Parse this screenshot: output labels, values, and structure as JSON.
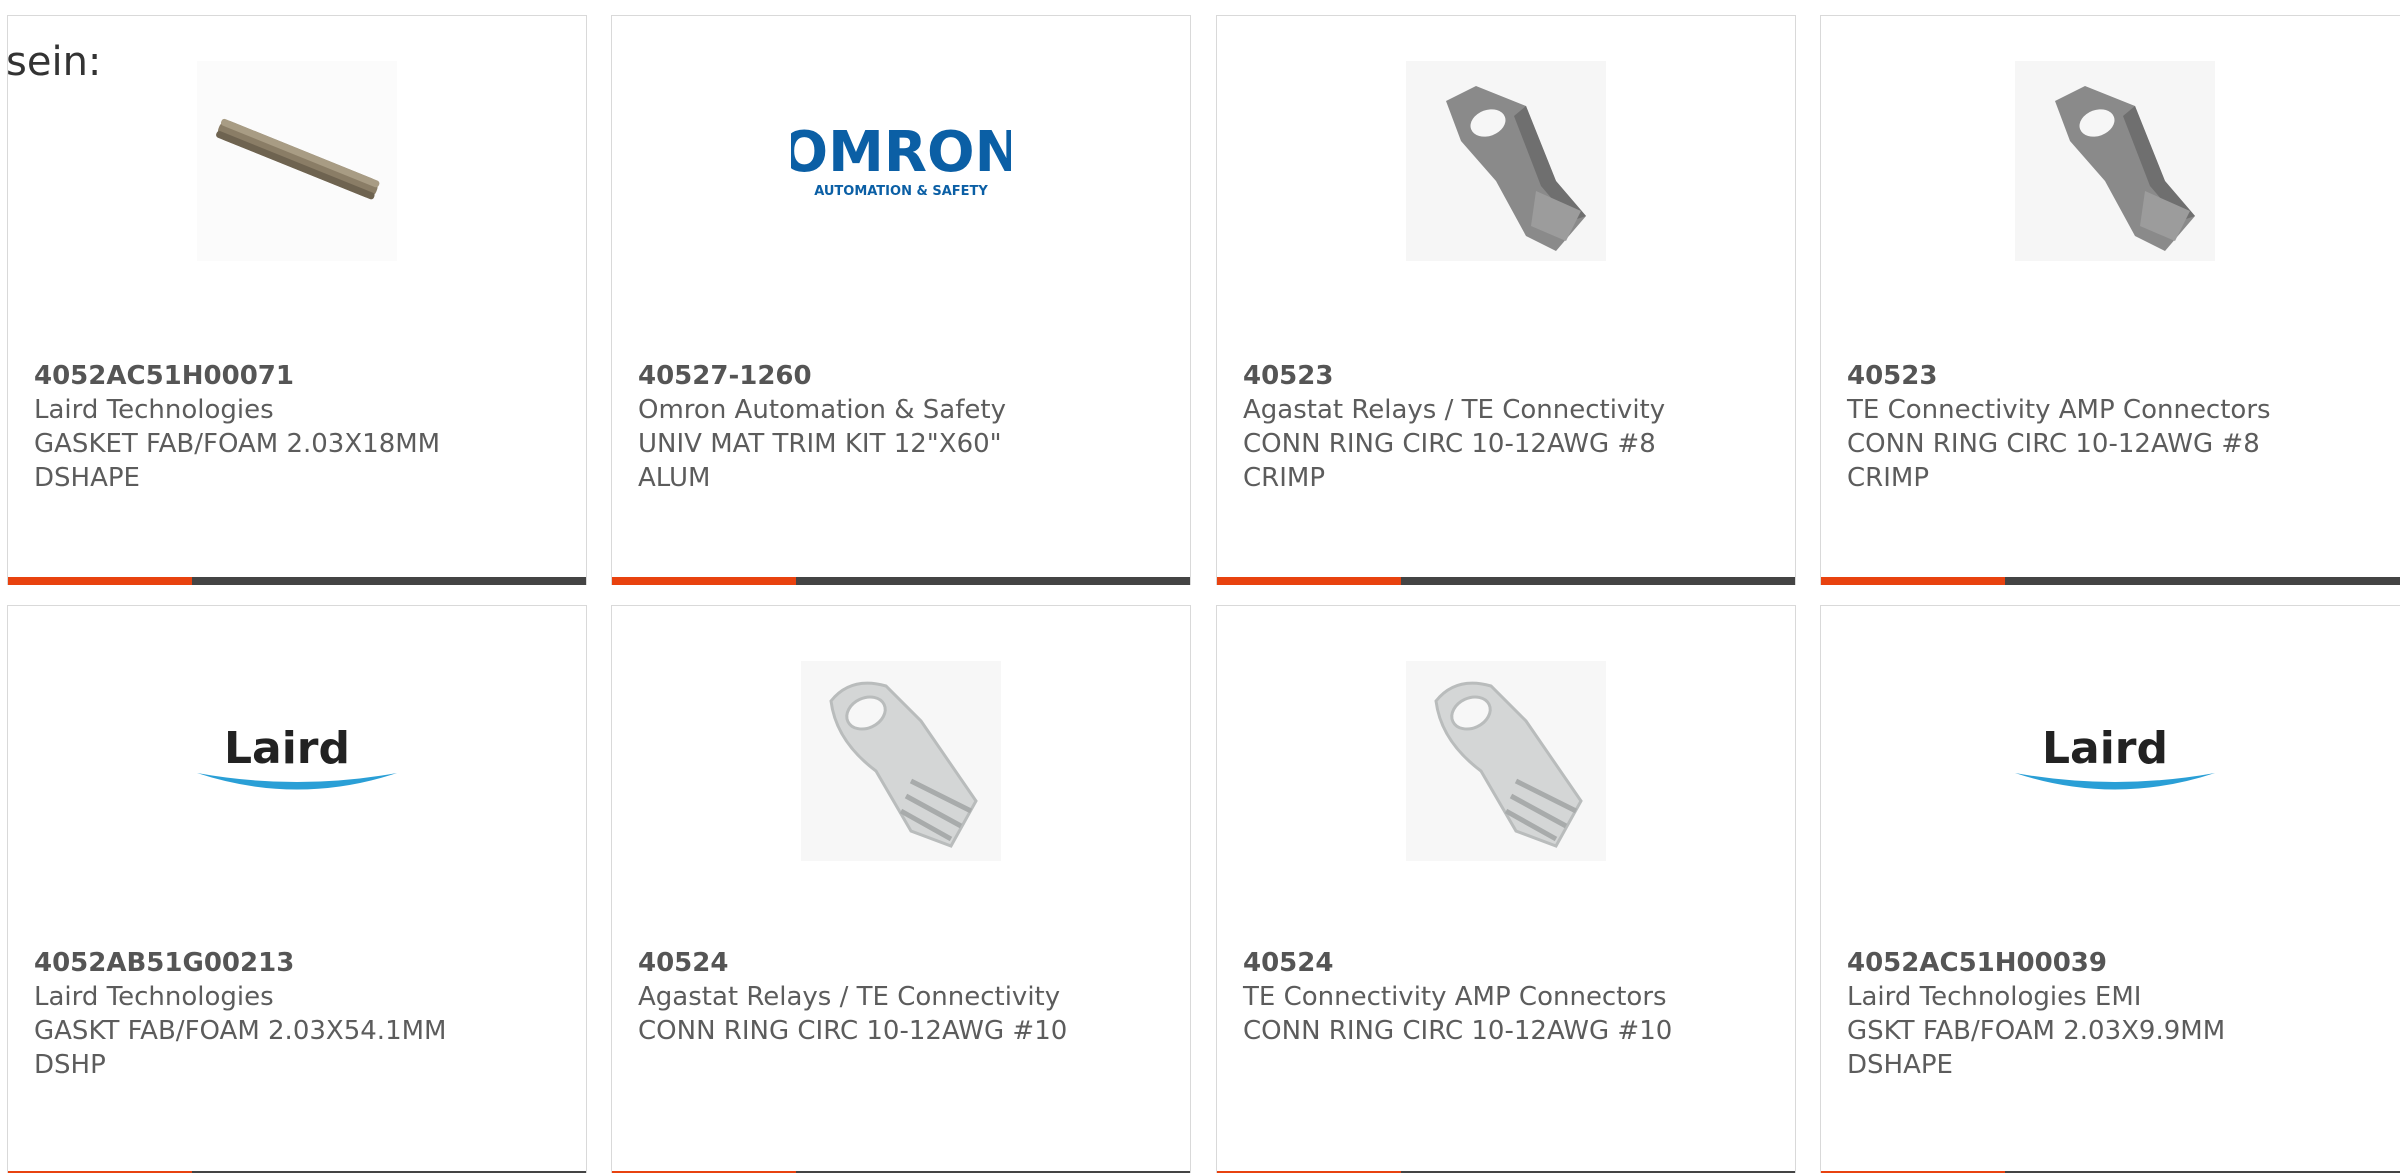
{
  "intro_text": "sein:",
  "colors": {
    "accent": "#e8420f",
    "bar": "#444444",
    "border": "#d9d9d9",
    "text": "#5c5c5c"
  },
  "products": [
    {
      "part": "4052AC51H00071",
      "manufacturer": "Laird Technologies",
      "desc1": "GASKET FAB/FOAM 2.03X18MM",
      "desc2": "DSHAPE",
      "image": "gasket-rod"
    },
    {
      "part": "40527-1260",
      "manufacturer": "Omron Automation & Safety",
      "desc1": "UNIV MAT TRIM KIT 12\"X60\"",
      "desc2": "ALUM",
      "image": "omron-logo",
      "logo_text": "OMRON",
      "logo_sub": "AUTOMATION & SAFETY"
    },
    {
      "part": "40523",
      "manufacturer": "Agastat Relays / TE Connectivity",
      "desc1": "CONN RING CIRC 10-12AWG #8",
      "desc2": "CRIMP",
      "image": "ring-terminal-gray"
    },
    {
      "part": "40523",
      "manufacturer": "TE Connectivity AMP Connectors",
      "desc1": "CONN RING CIRC 10-12AWG #8",
      "desc2": "CRIMP",
      "image": "ring-terminal-gray"
    },
    {
      "part": "4052AB51G00213",
      "manufacturer": "Laird Technologies",
      "desc1": "GASKT FAB/FOAM 2.03X54.1MM",
      "desc2": "DSHP",
      "image": "laird-logo",
      "logo_text": "Laird"
    },
    {
      "part": "40524",
      "manufacturer": "Agastat Relays / TE Connectivity",
      "desc1": "CONN RING CIRC 10-12AWG #10",
      "desc2": "",
      "image": "ring-terminal-clear"
    },
    {
      "part": "40524",
      "manufacturer": "TE Connectivity AMP Connectors",
      "desc1": "CONN RING CIRC 10-12AWG #10",
      "desc2": "",
      "image": "ring-terminal-clear"
    },
    {
      "part": "4052AC51H00039",
      "manufacturer": "Laird Technologies EMI",
      "desc1": "GSKT FAB/FOAM 2.03X9.9MM",
      "desc2": "DSHAPE",
      "image": "laird-logo",
      "logo_text": "Laird"
    }
  ]
}
